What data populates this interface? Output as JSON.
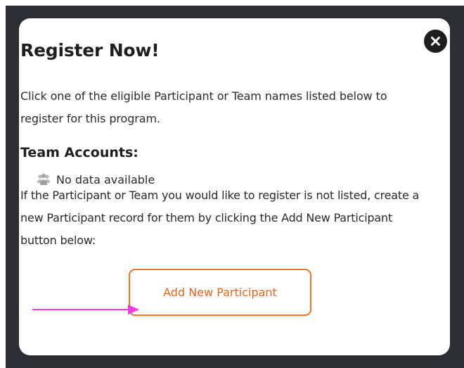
{
  "modal": {
    "title": "Register Now!",
    "intro": "Click one of the eligible Participant or Team names listed below to register for this program.",
    "team_accounts_heading": "Team Accounts:",
    "no_data_text": "No data available",
    "info_text": "If the Participant or Team you would like to register is not listed, create a new Participant record for them by clicking the Add New Participant button below:",
    "add_button_label": "Add New Participant"
  },
  "icons": {
    "close": "close-icon",
    "team": "group-icon",
    "pointer": "arrow-right-icon"
  },
  "colors": {
    "accent": "#f07320",
    "button_text": "#e8641a",
    "annotation_arrow": "#f03ce6",
    "backdrop": "#2b2d33"
  }
}
